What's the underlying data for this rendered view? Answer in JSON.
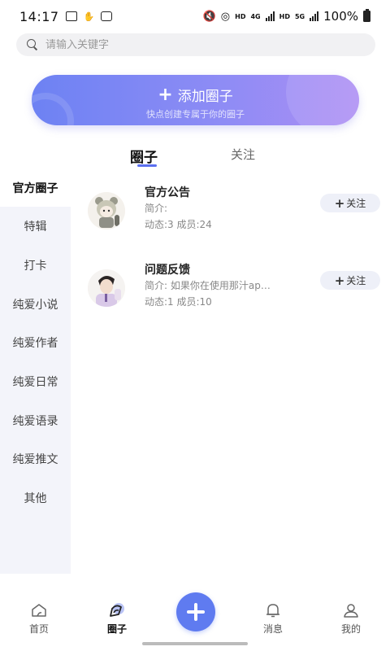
{
  "status_bar": {
    "time": "14:17",
    "battery": "100%",
    "hd1": "HD",
    "net1": "4G",
    "hd2": "HD",
    "net2": "5G"
  },
  "search": {
    "placeholder": "请输入关键字"
  },
  "banner": {
    "title": "添加圈子",
    "subtitle": "快点创建专属于你的圈子"
  },
  "tabs": [
    {
      "label": "圈子"
    },
    {
      "label": "关注"
    }
  ],
  "sidebar": {
    "items": [
      {
        "label": "官方圈子"
      },
      {
        "label": "特辑"
      },
      {
        "label": "打卡"
      },
      {
        "label": "纯爱小说"
      },
      {
        "label": "纯爱作者"
      },
      {
        "label": "纯爱日常"
      },
      {
        "label": "纯爱语录"
      },
      {
        "label": "纯爱推文"
      },
      {
        "label": "其他"
      }
    ]
  },
  "circles": [
    {
      "title": "官方公告",
      "intro": "简介:",
      "stats": "动态:3  成员:24",
      "follow_label": "关注"
    },
    {
      "title": "问题反馈",
      "intro": "简介:  如果你在使用那汁ap…",
      "stats": "动态:1  成员:10",
      "follow_label": "关注"
    }
  ],
  "bottom_nav": {
    "home": "首页",
    "circle": "圈子",
    "messages": "消息",
    "mine": "我的"
  },
  "colors": {
    "accent": "#5f7bf0",
    "banner_start": "#6d82f3",
    "banner_end": "#ad8ef4",
    "sidebar_bg": "#f3f4fa"
  }
}
